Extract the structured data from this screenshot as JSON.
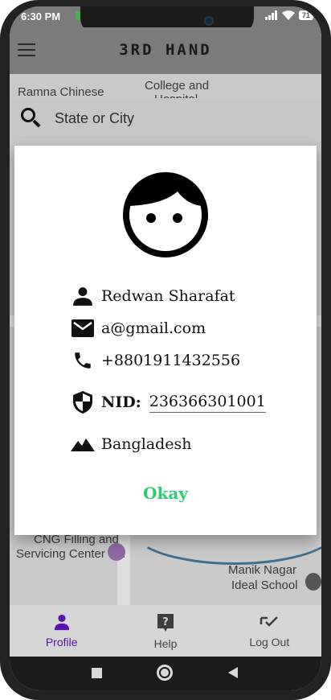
{
  "status_bar": {
    "time": "6:30 PM",
    "battery": "71"
  },
  "app_bar": {
    "title": "3RD HAND"
  },
  "search": {
    "placeholder": "State or City"
  },
  "map": {
    "labels": [
      "Ramna Chinese",
      "College and",
      "Hospital",
      "CNG Filling and",
      "Servicing Center Ltd",
      "Manik Nagar",
      "Ideal School"
    ]
  },
  "dialog": {
    "name": "Redwan Sharafat",
    "email": "a@gmail.com",
    "phone": "+8801911432556",
    "nid_label": "NID:",
    "nid_value": "236366301001",
    "country": "Bangladesh",
    "okay_label": "Okay",
    "accent_color": "#2ecc71"
  },
  "bottom_nav": {
    "items": [
      {
        "label": "Profile",
        "icon": "person-icon",
        "active": true
      },
      {
        "label": "Help",
        "icon": "help-icon",
        "active": false
      },
      {
        "label": "Log Out",
        "icon": "logout-check-icon",
        "active": false
      }
    ],
    "active_color": "#5a0fb0"
  }
}
